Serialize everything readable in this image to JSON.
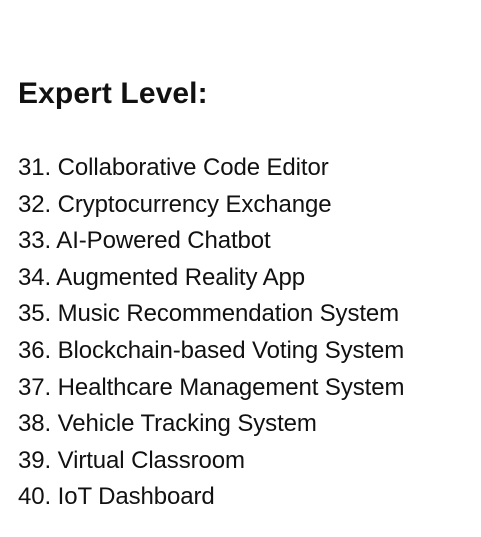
{
  "heading": "Expert Level:",
  "items": [
    "31. Collaborative Code Editor",
    "32. Cryptocurrency Exchange",
    "33. AI-Powered Chatbot",
    "34. Augmented Reality App",
    "35. Music Recommendation System",
    "36. Blockchain-based Voting System",
    "37. Healthcare Management System",
    "38. Vehicle Tracking System",
    "39. Virtual Classroom",
    "40. IoT Dashboard"
  ]
}
